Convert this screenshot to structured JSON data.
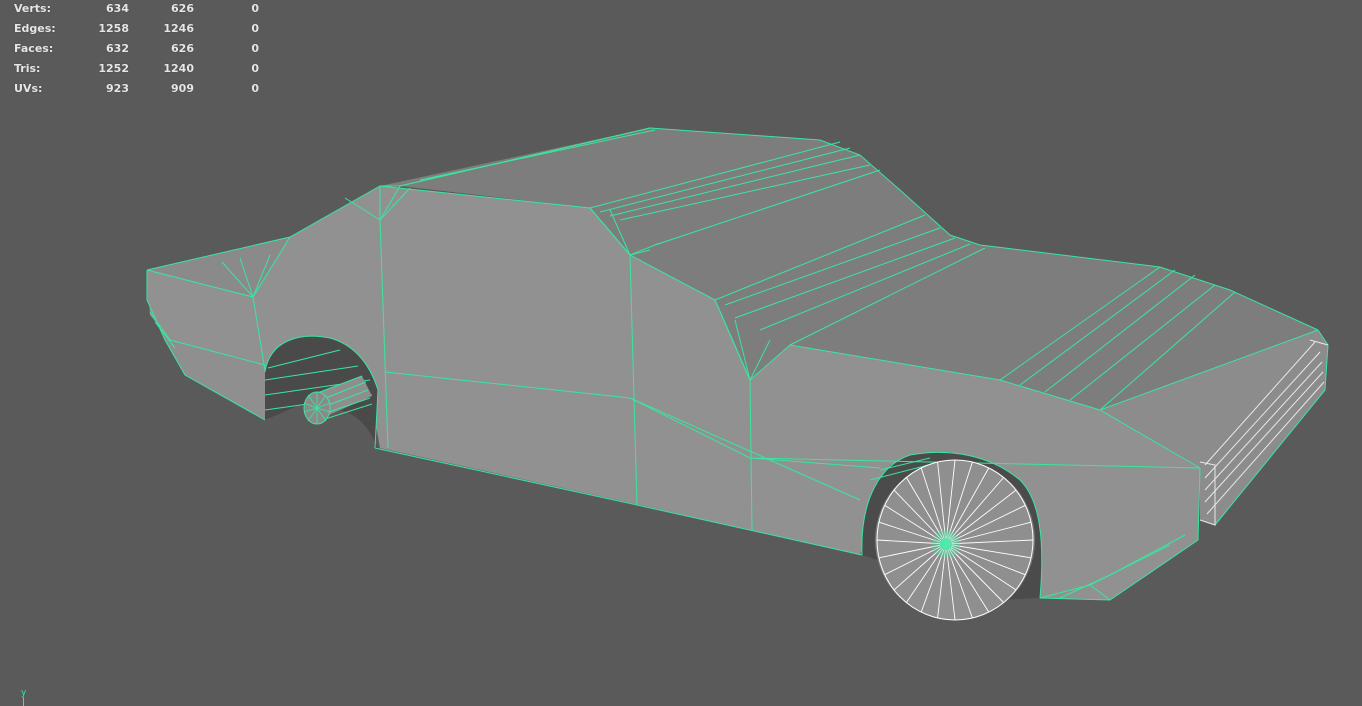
{
  "hud": {
    "rows": [
      {
        "label": "Verts:",
        "values": [
          "634",
          "626",
          "0"
        ]
      },
      {
        "label": "Edges:",
        "values": [
          "1258",
          "1246",
          "0"
        ]
      },
      {
        "label": "Faces:",
        "values": [
          "632",
          "626",
          "0"
        ]
      },
      {
        "label": "Tris:",
        "values": [
          "1252",
          "1240",
          "0"
        ]
      },
      {
        "label": "UVs:",
        "values": [
          "923",
          "909",
          "0"
        ]
      }
    ]
  },
  "axis": {
    "label": "y"
  },
  "colors": {
    "background": "#5a5a5a",
    "wireframe": "#39e6a0",
    "wheel_wire": "#ffffff",
    "body_light": "#909090",
    "body_dark": "#7b7b7b",
    "hud_text": "#e6e6e6"
  },
  "scene": {
    "object": "car-mesh",
    "display": "wireframe-on-shaded",
    "selection": "selected"
  }
}
